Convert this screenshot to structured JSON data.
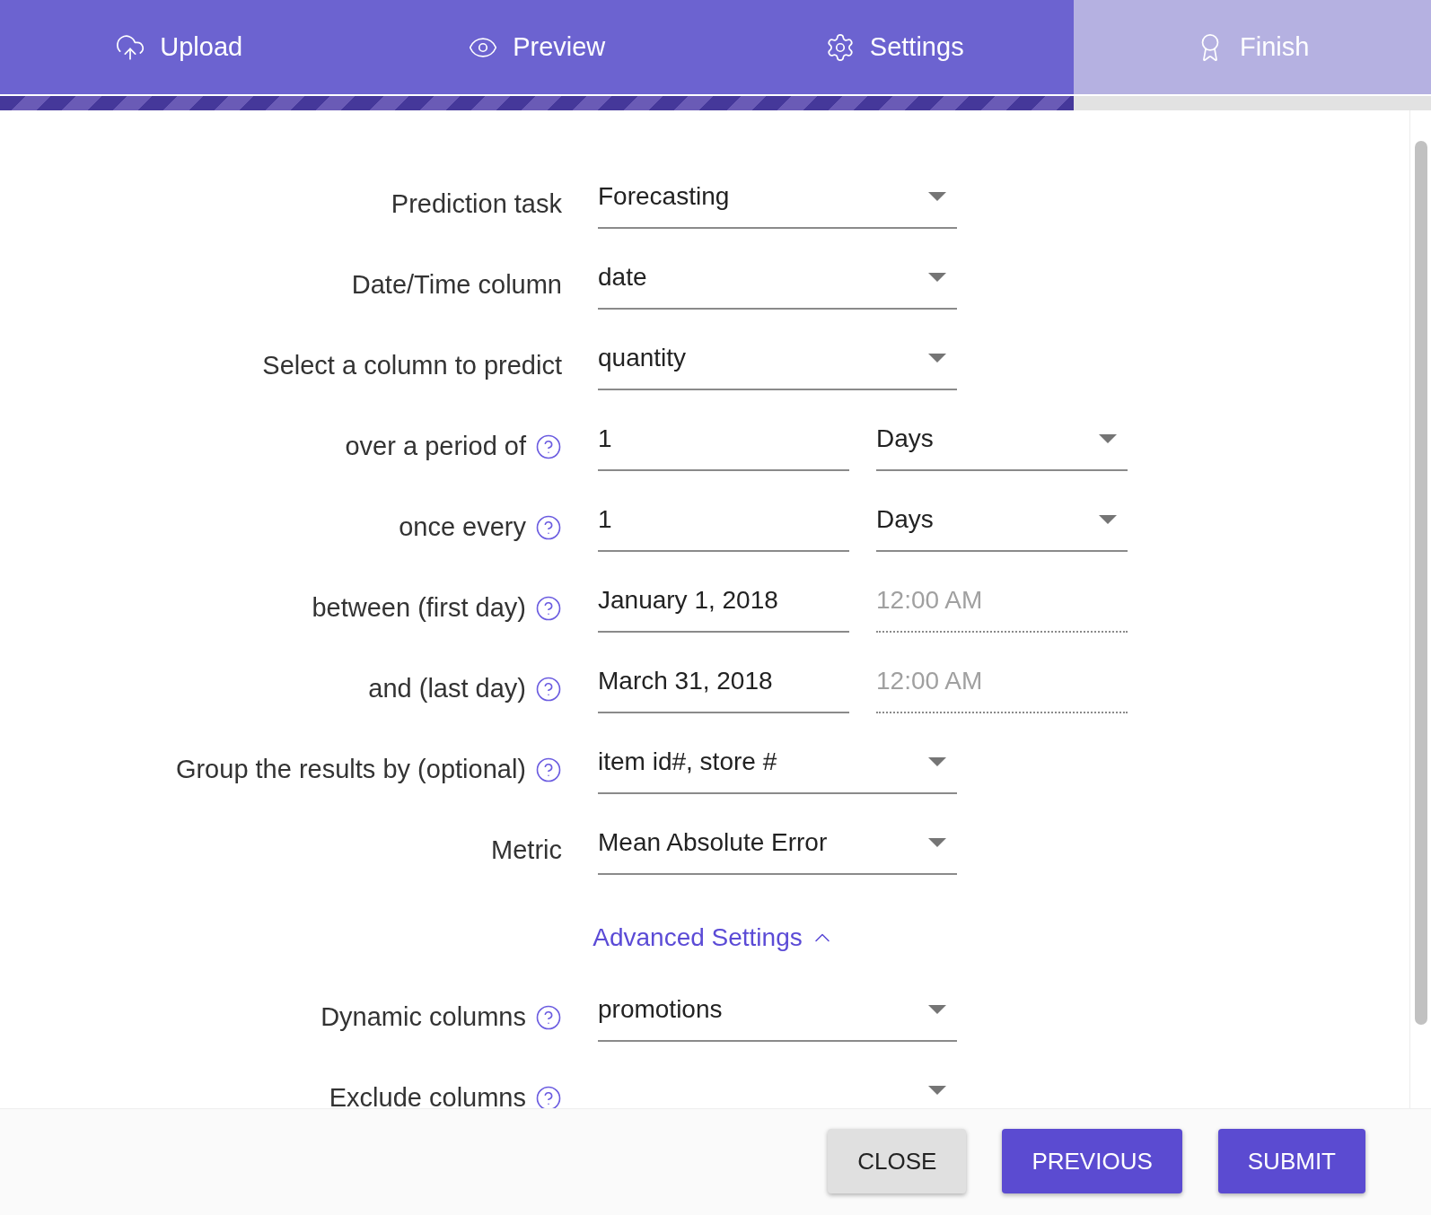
{
  "steps": [
    {
      "label": "Upload",
      "kind": "upload",
      "completed": true
    },
    {
      "label": "Preview",
      "kind": "preview",
      "completed": true
    },
    {
      "label": "Settings",
      "kind": "settings",
      "completed": true
    },
    {
      "label": "Finish",
      "kind": "finish",
      "completed": false
    }
  ],
  "form": {
    "rows": [
      {
        "label": "Prediction task",
        "help": false,
        "kind": "select",
        "value": "Forecasting"
      },
      {
        "label": "Date/Time column",
        "help": false,
        "kind": "select",
        "value": "date"
      },
      {
        "label": "Select a column to predict",
        "help": false,
        "kind": "select",
        "value": "quantity"
      },
      {
        "label": "over a period of",
        "help": true,
        "kind": "number_unit",
        "value": "1",
        "unit": "Days"
      },
      {
        "label": "once every",
        "help": true,
        "kind": "number_unit",
        "value": "1",
        "unit": "Days"
      },
      {
        "label": "between (first day)",
        "help": true,
        "kind": "datetime",
        "value": "January 1, 2018",
        "placeholder": "12:00 AM"
      },
      {
        "label": "and (last day)",
        "help": true,
        "kind": "datetime",
        "value": "March 31, 2018",
        "placeholder": "12:00 AM"
      },
      {
        "label": "Group the results by (optional)",
        "help": true,
        "kind": "select",
        "value": "item id#, store #"
      },
      {
        "label": "Metric",
        "help": false,
        "kind": "select",
        "value": "Mean Absolute Error"
      }
    ],
    "advanced": {
      "label": "Advanced Settings",
      "expanded": true
    },
    "advanced_rows": [
      {
        "label": "Dynamic columns",
        "help": true,
        "kind": "select",
        "value": "promotions"
      },
      {
        "label": "Exclude columns",
        "help": true,
        "kind": "select"
      }
    ]
  },
  "buttons": [
    {
      "label": "CLOSE",
      "kind": "secondary"
    },
    {
      "label": "PREVIOUS",
      "kind": "primary"
    },
    {
      "label": "SUBMIT",
      "kind": "primary"
    }
  ]
}
